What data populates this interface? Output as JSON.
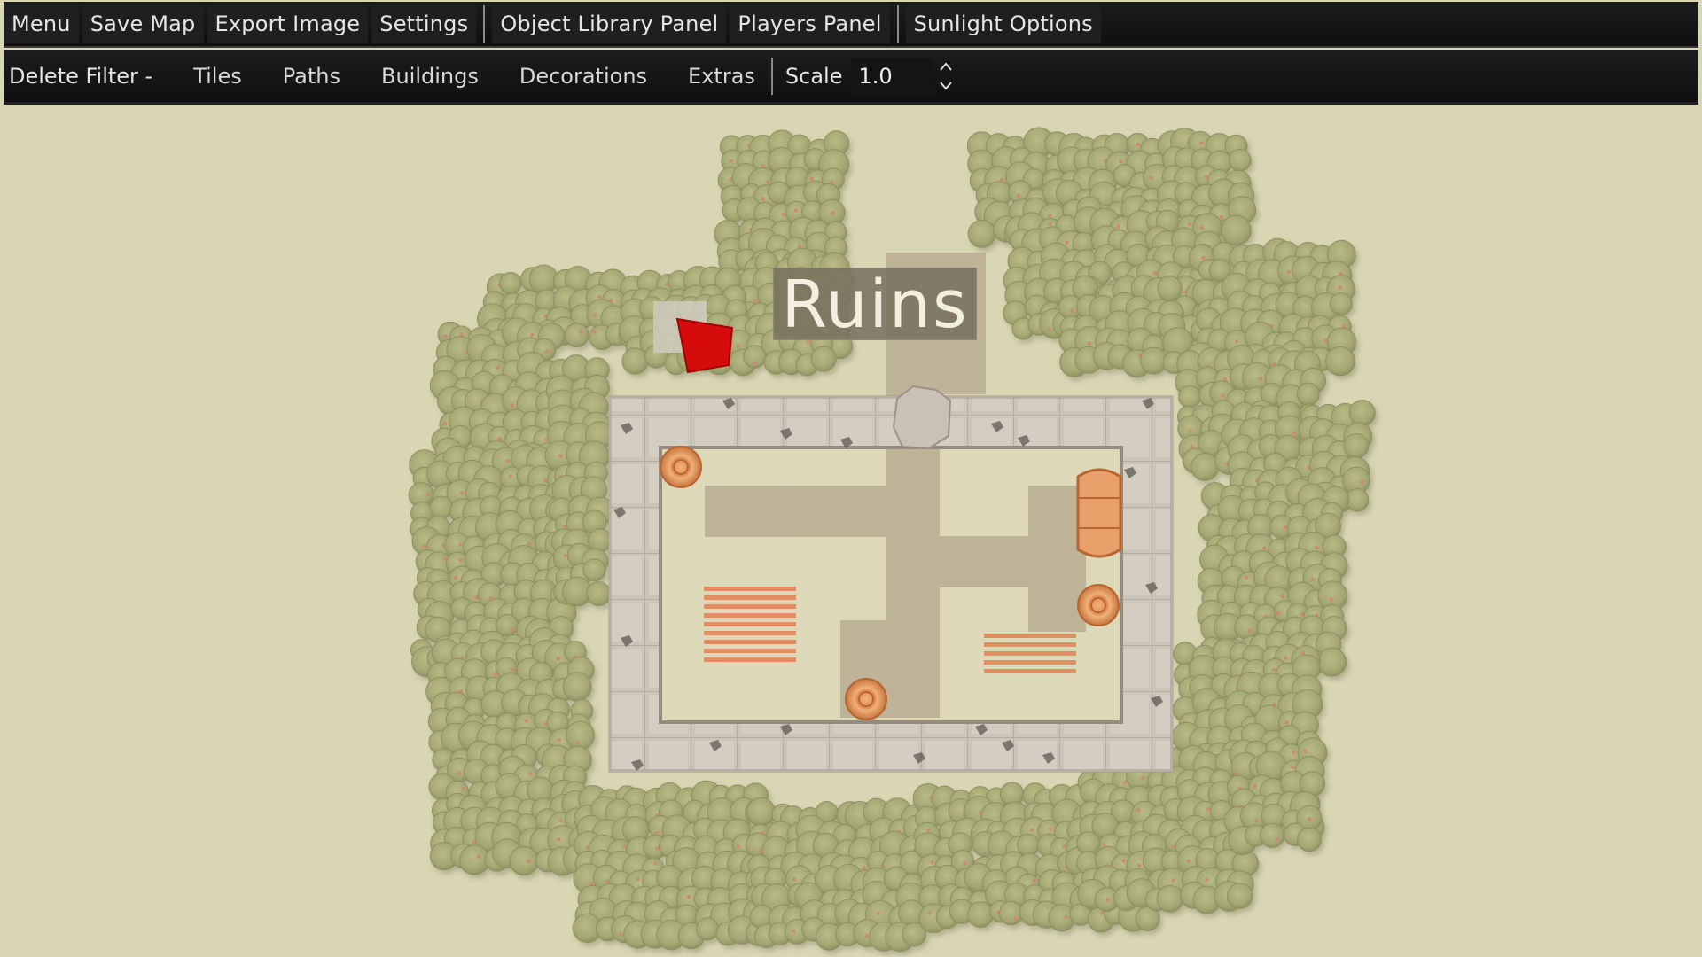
{
  "menubar": {
    "menu": "Menu",
    "save_map": "Save Map",
    "export_image": "Export Image",
    "settings": "Settings",
    "object_library_panel": "Object Library Panel",
    "players_panel": "Players Panel",
    "sunlight_options": "Sunlight Options"
  },
  "filterbar": {
    "delete_filter_label": "Delete Filter -",
    "filters": [
      "Tiles",
      "Paths",
      "Buildings",
      "Decorations",
      "Extras"
    ],
    "scale_label": "Scale",
    "scale_value": "1.0"
  },
  "map": {
    "label": "Ruins",
    "colors": {
      "ground": "#d9d6b4",
      "foliage": "#a9ac78",
      "wall": "#cbc4b8",
      "wall_dark": "#a39b90",
      "dirt": "#b7aa90",
      "grass_inner": "#dcd8b8",
      "crop": "#e08e62",
      "barrel": "#e49a5e",
      "marker": "#d60c0c"
    },
    "icons": [
      "red-marker-icon",
      "barrel-icon",
      "log-icon",
      "crop-row-icon",
      "tree-icon"
    ]
  }
}
